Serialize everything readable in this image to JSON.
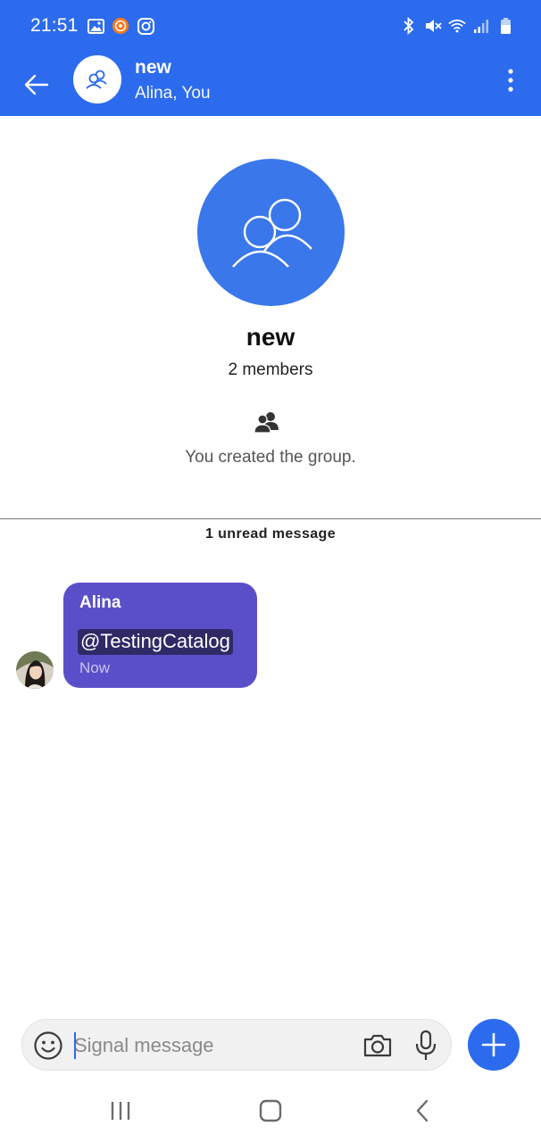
{
  "status_bar": {
    "time": "21:51",
    "icons_left": [
      "gallery-icon",
      "mi-app-icon",
      "instagram-icon"
    ],
    "icons_right": [
      "bluetooth-icon",
      "mute-icon",
      "wifi-icon",
      "signal-icon",
      "battery-icon"
    ]
  },
  "header": {
    "title": "new",
    "subtitle": "Alina, You",
    "back_icon": "arrow-left-icon",
    "avatar_icon": "group-icon",
    "menu_icon": "more-vert-icon"
  },
  "group_info": {
    "name": "new",
    "members": "2 members",
    "event_text": "You created the group.",
    "event_icon": "group-filled-icon"
  },
  "unread_divider": "1 unread message",
  "messages": [
    {
      "sender": "Alina",
      "text": "@TestingCatalog",
      "time": "Now"
    }
  ],
  "composer": {
    "placeholder": "Signal message",
    "emoji_icon": "emoji-icon",
    "camera_icon": "camera-icon",
    "mic_icon": "mic-icon",
    "attach_icon": "plus-icon"
  },
  "nav_bar": {
    "recents_icon": "recents-icon",
    "home_icon": "home-icon",
    "back_icon": "back-icon"
  },
  "colors": {
    "primary": "#2c6bed",
    "bubble_incoming": "#5b4fc9",
    "mention_bg": "#2f2a66",
    "group_avatar": "#3a77ea"
  }
}
